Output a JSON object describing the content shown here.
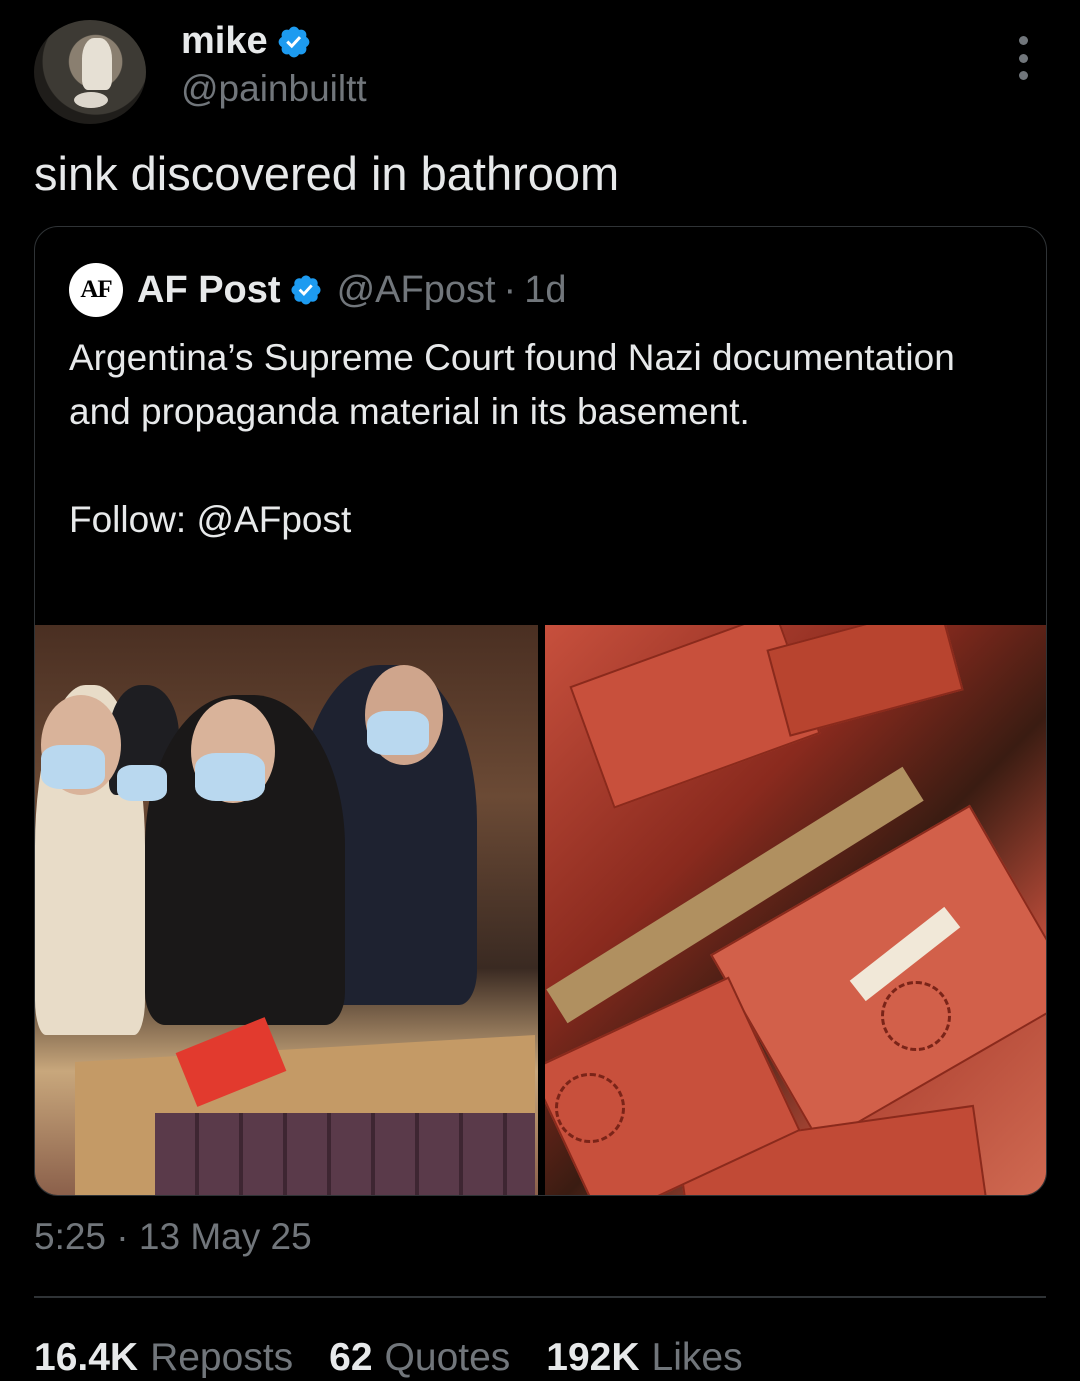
{
  "post": {
    "author_name": "mike",
    "author_handle": "@painbuiltt",
    "text": "sink discovered in bathroom",
    "timestamp": "5:25 · 13 May 25"
  },
  "quote": {
    "logo_text": "AF",
    "author_name": "AF Post",
    "author_handle": "@AFpost",
    "separator": "·",
    "time": "1d",
    "text": "Argentina’s Supreme Court found Nazi documentation and propaganda material in its basement.\n\nFollow: @AFpost"
  },
  "stats": {
    "reposts_count": "16.4K",
    "reposts_label": "Reposts",
    "quotes_count": "62",
    "quotes_label": "Quotes",
    "likes_count": "192K",
    "likes_label": "Likes"
  },
  "colors": {
    "background": "#000000",
    "text_primary": "#e7e9ea",
    "text_secondary": "#71767b",
    "verified_blue": "#1d9bf0",
    "border": "#2f3336"
  },
  "icons": {
    "verified": "verified-badge-icon",
    "more": "more-vertical-icon"
  }
}
